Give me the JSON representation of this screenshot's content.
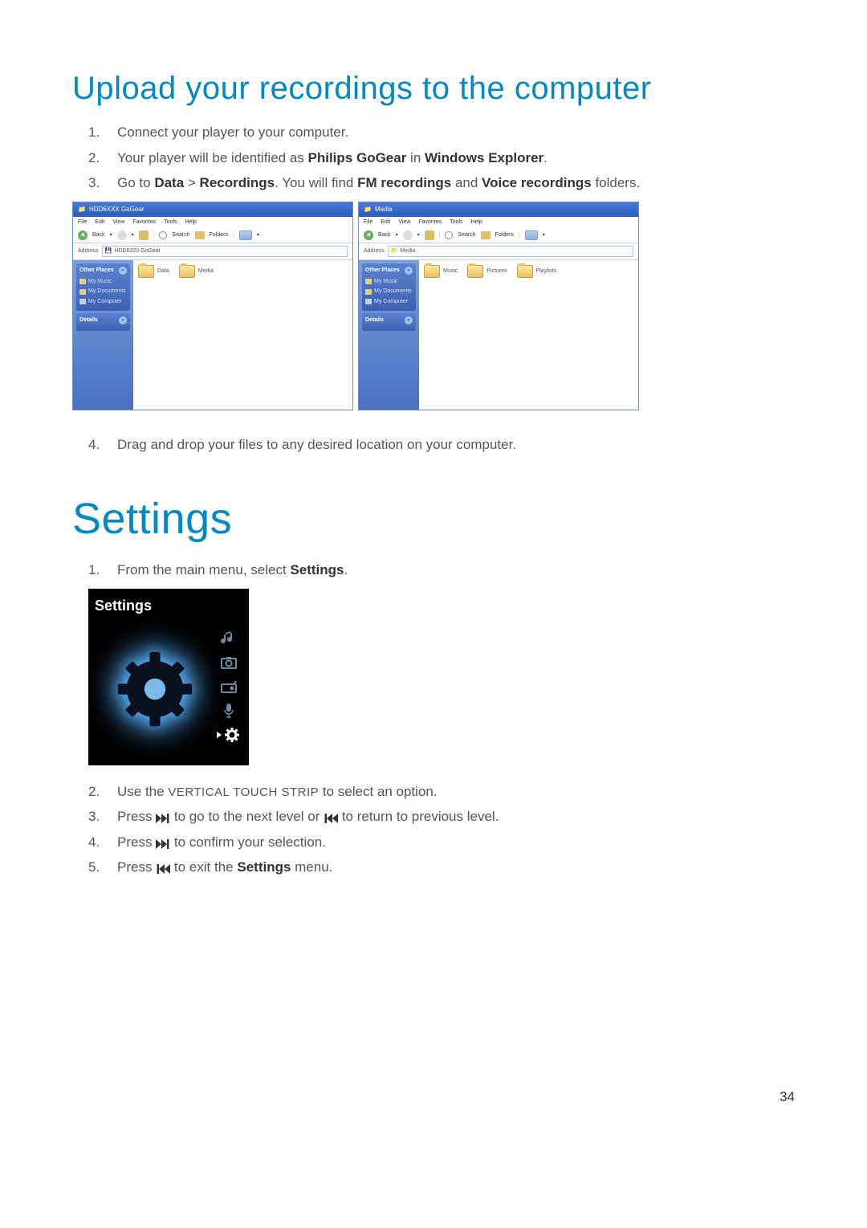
{
  "upload": {
    "title": "Upload your recordings to the computer",
    "steps": {
      "s1": "Connect your player to your computer.",
      "s2_pre": "Your player will be identified as ",
      "s2_b1": "Philips GoGear",
      "s2_mid": " in ",
      "s2_b2": "Windows Explorer",
      "s2_post": ".",
      "s3_pre": "Go to  ",
      "s3_b1": "Data",
      "s3_sep": " > ",
      "s3_b2": "Recordings",
      "s3_mid": ". You will find ",
      "s3_b3": "FM recordings",
      "s3_and": " and ",
      "s3_b4": "Voice recordings",
      "s3_post": " folders.",
      "s4": "Drag and drop your files to any desired location on your computer."
    }
  },
  "explorer1": {
    "title": "HDD6XXX GoGear",
    "menu": {
      "file": "File",
      "edit": "Edit",
      "view": "View",
      "fav": "Favorites",
      "tools": "Tools",
      "help": "Help"
    },
    "toolbar": {
      "back": "Back",
      "search": "Search",
      "folders": "Folders"
    },
    "address_label": "Address",
    "address_value": "HDD6320 GoGear",
    "sidebar": {
      "other_places": "Other Places",
      "my_music": "My Music",
      "my_documents": "My Documents",
      "my_computer": "My Computer",
      "details": "Details"
    },
    "folders": {
      "data": "Data",
      "media": "Media"
    }
  },
  "explorer2": {
    "title": "Media",
    "address_value": "Media",
    "folders": {
      "music": "Music",
      "pictures": "Pictures",
      "playlists": "Playlists"
    }
  },
  "settings": {
    "chapter": "Settings",
    "s1_pre": "From the main menu, select ",
    "s1_b": "Settings",
    "s1_post": ".",
    "screen_label": "Settings",
    "s2_pre": "Use the ",
    "s2_sc": "VERTICAL TOUCH STRIP",
    "s2_post": " to select an option.",
    "s3_pre": "Press ",
    "s3_mid": " to go to the next level or ",
    "s3_post": " to return to previous level.",
    "s4_pre": "Press ",
    "s4_post": " to confirm your selection.",
    "s5_pre": "Press ",
    "s5_mid": " to exit the ",
    "s5_b": "Settings",
    "s5_post": " menu."
  },
  "page_number": "34"
}
